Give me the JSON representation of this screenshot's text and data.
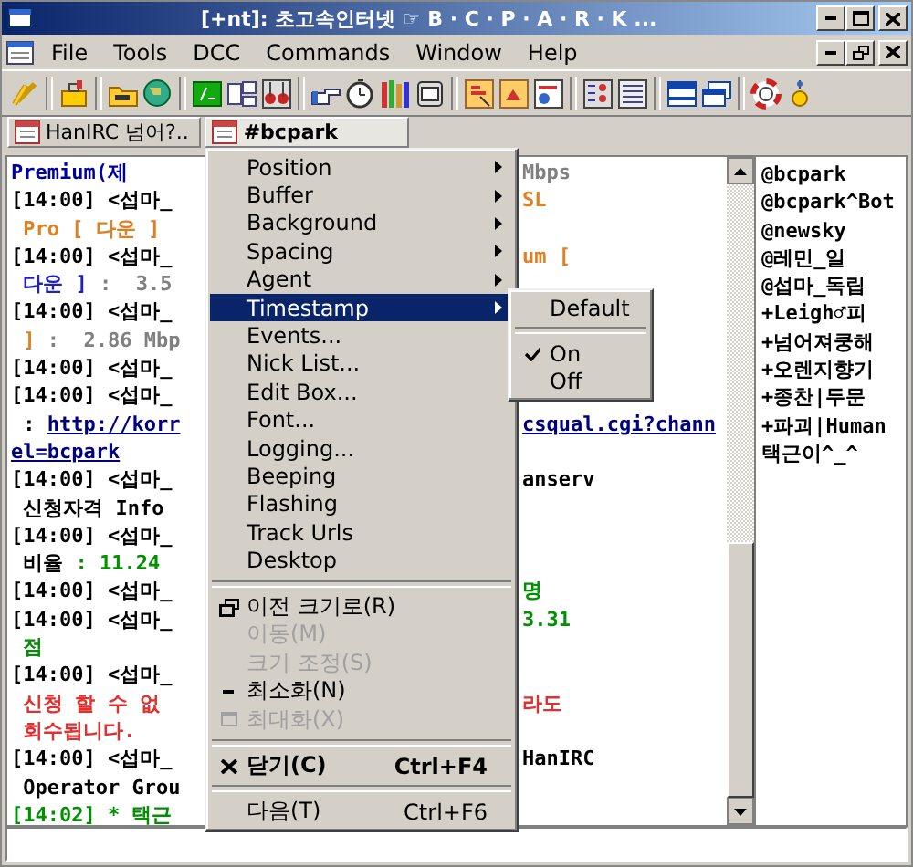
{
  "window": {
    "title": "[+nt]: 초고속인터넷 ☞ B · C · P · A · R · K ..."
  },
  "menubar": [
    {
      "label": "File"
    },
    {
      "label": "Tools"
    },
    {
      "label": "DCC"
    },
    {
      "label": "Commands"
    },
    {
      "label": "Window"
    },
    {
      "label": "Help"
    }
  ],
  "tabs": [
    {
      "label": "HanIRC 넘어?..",
      "selected": false
    },
    {
      "label": "#bcpark",
      "selected": true
    }
  ],
  "chat_lines": [
    {
      "left": [
        {
          "text": "Premium(제",
          "color": "#0000a0"
        }
      ],
      "right": [
        {
          "text": "Mbps",
          "color": "#808080"
        }
      ]
    },
    {
      "left": [
        {
          "text": "[14:00] <섭마_",
          "color": "#000000"
        }
      ],
      "right": [
        {
          "text": "SL",
          "color": "#e08020"
        }
      ]
    },
    {
      "left": [
        {
          "text": " Pro [ 다운 ]",
          "color": "#e08020"
        }
      ]
    },
    {
      "left": [
        {
          "text": "[14:00] <섭마_",
          "color": "#000000"
        }
      ],
      "right": [
        {
          "text": "um [",
          "color": "#e08020"
        }
      ]
    },
    {
      "left": [
        {
          "text": " 다운 ]",
          "color": "#2020c0"
        },
        {
          "text": " :  3.5",
          "color": "#808080"
        }
      ]
    },
    {
      "left": [
        {
          "text": "[14:00] <섭마_",
          "color": "#000000"
        }
      ]
    },
    {
      "left": [
        {
          "text": " ]",
          "color": "#e08020"
        },
        {
          "text": " :  2.86 Mbp",
          "color": "#808080"
        }
      ]
    },
    {
      "left": [
        {
          "text": "[14:00] <섭마_",
          "color": "#000000"
        }
      ]
    },
    {
      "left": [
        {
          "text": "[14:00] <섭마_",
          "color": "#000000"
        }
      ]
    },
    {
      "left": [
        {
          "text": " : ",
          "color": "#000000"
        },
        {
          "text": "http://korr",
          "color": "#000080",
          "kind": "link"
        }
      ],
      "right": [
        {
          "text": "csqual.cgi?chann",
          "color": "#000080",
          "kind": "link"
        }
      ]
    },
    {
      "left": [
        {
          "text": " el=bcpark",
          "color": "#000080",
          "kind": "link"
        }
      ]
    },
    {
      "left": [
        {
          "text": "[14:00] <섭마_",
          "color": "#000000"
        }
      ],
      "right": [
        {
          "text": "anserv",
          "color": "#000000"
        }
      ]
    },
    {
      "left": [
        {
          "text": " 신청자격 Info",
          "color": "#000000"
        }
      ]
    },
    {
      "left": [
        {
          "text": "[14:00] <섭마_",
          "color": "#000000"
        }
      ]
    },
    {
      "left": [
        {
          "text": " 비율 ",
          "color": "#000000"
        },
        {
          "text": ": 11.24",
          "color": "#009000"
        }
      ]
    },
    {
      "left": [
        {
          "text": "[14:00] <섭마_",
          "color": "#000000"
        }
      ],
      "right": [
        {
          "text": "명",
          "color": "#009000"
        }
      ]
    },
    {
      "left": [
        {
          "text": "[14:00] <섭마_",
          "color": "#000000"
        }
      ],
      "right": [
        {
          "text": "3.31",
          "color": "#009000"
        }
      ]
    },
    {
      "left": [
        {
          "text": " 점",
          "color": "#009000"
        }
      ]
    },
    {
      "left": [
        {
          "text": "[14:00] <섭마_",
          "color": "#000000"
        }
      ]
    },
    {
      "left": [
        {
          "text": " 신청 할 수 없",
          "color": "#e03030"
        }
      ],
      "right": [
        {
          "text": "라도",
          "color": "#e03030"
        }
      ]
    },
    {
      "left": [
        {
          "text": " 회수됩니다.",
          "color": "#e03030"
        }
      ]
    },
    {
      "left": [
        {
          "text": "[14:00] <섭마_",
          "color": "#000000"
        }
      ],
      "right": [
        {
          "text": "HanIRC",
          "color": "#000000"
        }
      ]
    },
    {
      "left": [
        {
          "text": " Operator Grou",
          "color": "#000000"
        }
      ]
    },
    {
      "left": [
        {
          "text": "[14:02] * 택근",
          "color": "#009000"
        }
      ]
    }
  ],
  "nick_list": [
    "@bcpark",
    "@bcpark^Bot",
    "@newsky",
    "@레민_일",
    "@섭마_독립",
    "+Leigh♂피",
    "+넘어져쿵해",
    "+오렌지향기",
    "+종찬|두문",
    "+파괴|Human",
    "택근이^_^"
  ],
  "context_menu": [
    {
      "kind": "submenu",
      "label": "Position",
      "selected": false
    },
    {
      "kind": "submenu",
      "label": "Buffer",
      "selected": false
    },
    {
      "kind": "submenu",
      "label": "Background",
      "selected": false
    },
    {
      "kind": "submenu",
      "label": "Spacing",
      "selected": false
    },
    {
      "kind": "submenu",
      "label": "Agent",
      "selected": false
    },
    {
      "kind": "submenu",
      "label": "Timestamp",
      "selected": true
    },
    {
      "kind": "item",
      "label": "Events...",
      "selected": false
    },
    {
      "kind": "item",
      "label": "Nick List...",
      "selected": false
    },
    {
      "kind": "item",
      "label": "Edit Box...",
      "selected": false
    },
    {
      "kind": "item",
      "label": "Font...",
      "selected": false
    },
    {
      "kind": "item",
      "label": "Logging...",
      "selected": false
    },
    {
      "kind": "item",
      "label": "Beeping",
      "selected": false
    },
    {
      "kind": "item",
      "label": "Flashing",
      "selected": false
    },
    {
      "kind": "item",
      "label": "Track Urls",
      "selected": false
    },
    {
      "kind": "item",
      "label": "Desktop",
      "selected": false
    },
    {
      "kind": "separator"
    },
    {
      "kind": "restore",
      "label": "이전 크기로(R)",
      "disabled": false,
      "selected": false
    },
    {
      "kind": "item",
      "label": "이동(M)",
      "disabled": true,
      "selected": false
    },
    {
      "kind": "item",
      "label": "크기 조정(S)",
      "disabled": true,
      "selected": false
    },
    {
      "kind": "minimize",
      "label": "최소화(N)",
      "disabled": false,
      "selected": false
    },
    {
      "kind": "maximize",
      "label": "최대화(X)",
      "disabled": true,
      "selected": false
    },
    {
      "kind": "separator"
    },
    {
      "kind": "close",
      "label": "닫기(C)",
      "shortcut": "Ctrl+F4",
      "bold": true,
      "selected": false
    },
    {
      "kind": "separator"
    },
    {
      "kind": "item",
      "label": "다음(T)",
      "shortcut": "Ctrl+F6",
      "selected": false
    }
  ],
  "submenu": [
    {
      "kind": "item",
      "label": "Default",
      "checked": false
    },
    {
      "kind": "separator"
    },
    {
      "kind": "item",
      "label": "On",
      "checked": true
    },
    {
      "kind": "item",
      "label": "Off",
      "checked": false
    }
  ]
}
